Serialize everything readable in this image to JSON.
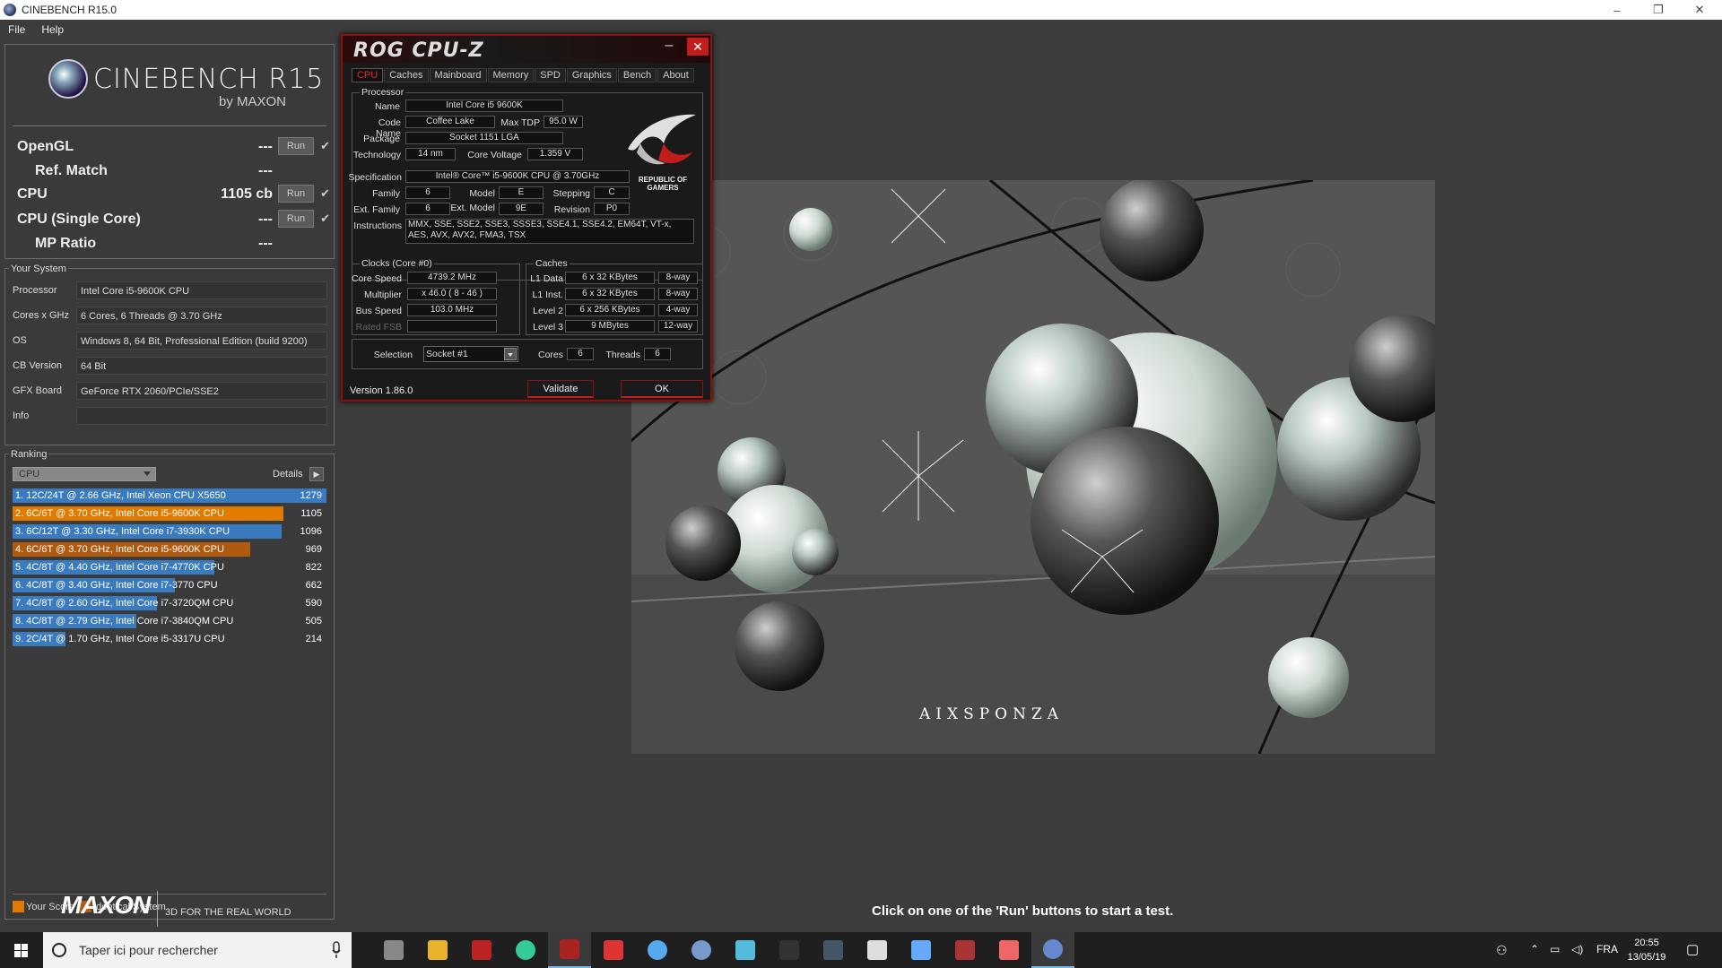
{
  "window": {
    "title": "CINEBENCH R15.0",
    "controls": [
      "–",
      "❐",
      "✕"
    ]
  },
  "menu": [
    "File",
    "Help"
  ],
  "logo": {
    "name": "CINEBENCH R15",
    "sub": "by MAXON"
  },
  "tests": [
    {
      "label": "OpenGL",
      "value": "---",
      "run": "Run",
      "checked": true
    },
    {
      "label": "Ref. Match",
      "value": "---"
    },
    {
      "label": "CPU",
      "value": "1105 cb",
      "run": "Run",
      "checked": true
    },
    {
      "label": "CPU (Single Core)",
      "value": "---",
      "run": "Run",
      "checked": true
    },
    {
      "label": "MP Ratio",
      "value": "---"
    }
  ],
  "your_system": {
    "title": "Your System",
    "rows": [
      {
        "k": "Processor",
        "v": "Intel Core i5-9600K CPU"
      },
      {
        "k": "Cores x GHz",
        "v": "6 Cores, 6 Threads @ 3.70 GHz"
      },
      {
        "k": "OS",
        "v": "Windows 8, 64 Bit, Professional Edition (build 9200)"
      },
      {
        "k": "CB Version",
        "v": "64 Bit"
      },
      {
        "k": "GFX Board",
        "v": "GeForce RTX 2060/PCIe/SSE2"
      },
      {
        "k": "Info",
        "v": ""
      }
    ]
  },
  "ranking": {
    "title": "Ranking",
    "select": "CPU",
    "details": "Details",
    "max_score": 1279,
    "rows": [
      {
        "label": "1. 12C/24T @ 2.66 GHz, Intel Xeon CPU X5650",
        "score": "1279",
        "kind": "ref"
      },
      {
        "label": "2. 6C/6T @ 3.70 GHz, Intel Core i5-9600K CPU",
        "score": "1105",
        "kind": "yours"
      },
      {
        "label": "3. 6C/12T @ 3.30 GHz,  Intel Core i7-3930K CPU",
        "score": "1096",
        "kind": "ref"
      },
      {
        "label": "4. 6C/6T @ 3.70 GHz, Intel Core i5-9600K CPU",
        "score": "969",
        "kind": "identical"
      },
      {
        "label": "5. 4C/8T @ 4.40 GHz, Intel Core i7-4770K CPU",
        "score": "822",
        "kind": "ref"
      },
      {
        "label": "6. 4C/8T @ 3.40 GHz,  Intel Core i7-3770 CPU",
        "score": "662",
        "kind": "ref"
      },
      {
        "label": "7. 4C/8T @ 2.60 GHz, Intel Core i7-3720QM CPU",
        "score": "590",
        "kind": "ref"
      },
      {
        "label": "8. 4C/8T @ 2.79 GHz,  Intel Core i7-3840QM CPU",
        "score": "505",
        "kind": "ref"
      },
      {
        "label": "9. 2C/4T @ 1.70 GHz,  Intel Core i5-3317U CPU",
        "score": "214",
        "kind": "ref"
      }
    ],
    "legend": {
      "yours": "Your Score",
      "identical": "Identical System"
    },
    "colors": {
      "ref": "#3a7bbf",
      "yours": "#e07b00",
      "identical": "#b05a10"
    }
  },
  "maxon": {
    "brand": "MAXON",
    "tagline": "3D FOR THE REAL WORLD"
  },
  "render": {
    "watermark": "AIXSPONZA",
    "hint": "Click on one of the 'Run' buttons to start a test."
  },
  "cpuz": {
    "title": "ROG CPU-Z",
    "tabs": [
      "CPU",
      "Caches",
      "Mainboard",
      "Memory",
      "SPD",
      "Graphics",
      "Bench",
      "About"
    ],
    "processor": {
      "group": "Processor",
      "name_lbl": "Name",
      "name": "Intel Core i5 9600K",
      "code_lbl": "Code Name",
      "code": "Coffee Lake",
      "tdp_lbl": "Max TDP",
      "tdp": "95.0 W",
      "pkg_lbl": "Package",
      "pkg": "Socket 1151 LGA",
      "tech_lbl": "Technology",
      "tech": "14 nm",
      "volt_lbl": "Core Voltage",
      "volt": "1.359 V",
      "spec_lbl": "Specification",
      "spec": "Intel® Core™ i5-9600K CPU @ 3.70GHz",
      "family_lbl": "Family",
      "family": "6",
      "model_lbl": "Model",
      "model": "E",
      "stepping_lbl": "Stepping",
      "stepping": "C",
      "extfam_lbl": "Ext. Family",
      "extfam": "6",
      "extmod_lbl": "Ext. Model",
      "extmod": "9E",
      "rev_lbl": "Revision",
      "rev": "P0",
      "inst_lbl": "Instructions",
      "inst1": "MMX, SSE, SSE2, SSE3, SSSE3, SSE4.1, SSE4.2, EM64T, VT-x,",
      "inst2": "AES, AVX, AVX2, FMA3, TSX"
    },
    "brand_text": "REPUBLIC OF GAMERS",
    "clocks": {
      "group": "Clocks (Core #0)",
      "speed_lbl": "Core Speed",
      "speed": "4739.2 MHz",
      "mult_lbl": "Multiplier",
      "mult": "x 46.0 ( 8 - 46 )",
      "bus_lbl": "Bus Speed",
      "bus": "103.0 MHz",
      "fsb_lbl": "Rated FSB",
      "fsb": ""
    },
    "caches": {
      "group": "Caches",
      "l1d_lbl": "L1 Data",
      "l1d": "6 x 32 KBytes",
      "l1d_w": "8-way",
      "l1i_lbl": "L1 Inst.",
      "l1i": "6 x 32 KBytes",
      "l1i_w": "8-way",
      "l2_lbl": "Level 2",
      "l2": "6 x 256 KBytes",
      "l2_w": "4-way",
      "l3_lbl": "Level 3",
      "l3": "9 MBytes",
      "l3_w": "12-way"
    },
    "selection_lbl": "Selection",
    "selection": "Socket #1",
    "cores_lbl": "Cores",
    "cores": "6",
    "threads_lbl": "Threads",
    "threads": "6",
    "version": "Version 1.86.0",
    "validate": "Validate",
    "ok": "OK"
  },
  "taskbar": {
    "search_placeholder": "Taper ici pour rechercher",
    "apps": [
      "task-view",
      "file-explorer",
      "red-app",
      "chrome",
      "rog-cpuz",
      "gpu-tuner",
      "rgb-app",
      "ring-app",
      "monitor-app",
      "epic-games",
      "steam",
      "mail",
      "notepad",
      "gaming-app",
      "bright-app",
      "cinebench"
    ],
    "lang": "FRA",
    "time": "20:55",
    "date": "13/05/19"
  }
}
